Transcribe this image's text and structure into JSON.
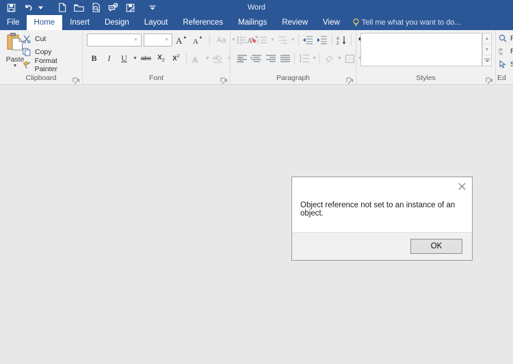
{
  "window": {
    "title": "Word",
    "titlebar_color": "#2b5797",
    "canvas_color": "#e8e8e8",
    "ribbon_color": "#f1f1f1"
  },
  "quick_access": {
    "items": [
      {
        "name": "save-icon",
        "tooltip": "Save"
      },
      {
        "name": "undo-icon",
        "tooltip": "Undo"
      },
      {
        "name": "undo-dropdown-caret-icon",
        "tooltip": "Undo options"
      },
      {
        "name": "new-document-icon",
        "tooltip": "New"
      },
      {
        "name": "open-folder-icon",
        "tooltip": "Open"
      },
      {
        "name": "print-preview-icon",
        "tooltip": "Print Preview and Print"
      },
      {
        "name": "spelling-grammar-icon",
        "tooltip": "Spelling & Grammar"
      },
      {
        "name": "save-as-icon",
        "tooltip": "Save As"
      },
      {
        "name": "customize-quick-access-caret-icon",
        "tooltip": "Customize Quick Access Toolbar"
      }
    ]
  },
  "tabs": [
    {
      "label": "File",
      "active": false,
      "name": "tab-file"
    },
    {
      "label": "Home",
      "active": true,
      "name": "tab-home"
    },
    {
      "label": "Insert",
      "active": false,
      "name": "tab-insert"
    },
    {
      "label": "Design",
      "active": false,
      "name": "tab-design"
    },
    {
      "label": "Layout",
      "active": false,
      "name": "tab-layout"
    },
    {
      "label": "References",
      "active": false,
      "name": "tab-references"
    },
    {
      "label": "Mailings",
      "active": false,
      "name": "tab-mailings"
    },
    {
      "label": "Review",
      "active": false,
      "name": "tab-review"
    },
    {
      "label": "View",
      "active": false,
      "name": "tab-view"
    }
  ],
  "tell_me": {
    "label": "Tell me what you want to do...",
    "icon": "lightbulb-icon"
  },
  "ribbon": {
    "groups": [
      {
        "name": "clipboard",
        "label": "Clipboard",
        "paste": {
          "label": "Paste",
          "icon": "paste-icon",
          "has_dropdown": true
        },
        "items": [
          {
            "label": "Cut",
            "icon": "scissors-icon"
          },
          {
            "label": "Copy",
            "icon": "copy-icon"
          },
          {
            "label": "Format Painter",
            "icon": "format-painter-icon"
          }
        ]
      },
      {
        "name": "font",
        "label": "Font",
        "font_name": {
          "value": "",
          "placeholder": ""
        },
        "font_size": {
          "value": "",
          "placeholder": ""
        },
        "row1": [
          {
            "label": "A",
            "icon": "grow-font-icon",
            "enabled": true
          },
          {
            "label": "A",
            "icon": "shrink-font-icon",
            "enabled": true
          },
          {
            "label": "Aa",
            "icon": "change-case-icon",
            "enabled": false
          },
          {
            "label": "",
            "icon": "clear-formatting-icon",
            "enabled": true
          }
        ],
        "row2": [
          {
            "label": "B",
            "icon": "bold-icon",
            "enabled": true
          },
          {
            "label": "I",
            "icon": "italic-icon",
            "enabled": true
          },
          {
            "label": "U",
            "icon": "underline-icon",
            "enabled": true
          },
          {
            "label": "abc",
            "icon": "strikethrough-icon",
            "enabled": true
          },
          {
            "label": "X2",
            "icon": "subscript-icon",
            "enabled": true
          },
          {
            "label": "X2",
            "icon": "superscript-icon",
            "enabled": true
          },
          {
            "label": "A",
            "icon": "text-effects-icon",
            "enabled": false
          },
          {
            "label": "ab",
            "icon": "text-highlight-color-icon",
            "enabled": false
          },
          {
            "label": "A",
            "icon": "font-color-icon",
            "enabled": false
          }
        ]
      },
      {
        "name": "paragraph",
        "label": "Paragraph",
        "row1": [
          {
            "icon": "bullets-icon",
            "enabled": false
          },
          {
            "icon": "numbering-icon",
            "enabled": false
          },
          {
            "icon": "multilevel-list-icon",
            "enabled": false
          },
          {
            "icon": "decrease-indent-icon",
            "enabled": true
          },
          {
            "icon": "increase-indent-icon",
            "enabled": true
          },
          {
            "icon": "sort-icon",
            "enabled": true
          },
          {
            "icon": "show-formatting-marks-icon",
            "enabled": true
          }
        ],
        "row2": [
          {
            "icon": "align-left-icon",
            "enabled": true
          },
          {
            "icon": "align-center-icon",
            "enabled": true
          },
          {
            "icon": "align-right-icon",
            "enabled": true
          },
          {
            "icon": "justify-icon",
            "enabled": true
          },
          {
            "icon": "line-spacing-icon",
            "enabled": false
          },
          {
            "icon": "shading-icon",
            "enabled": false
          },
          {
            "icon": "borders-icon",
            "enabled": false
          }
        ]
      },
      {
        "name": "styles",
        "label": "Styles",
        "gallery_empty": true,
        "scroll_buttons": [
          {
            "icon": "scroll-up-icon"
          },
          {
            "icon": "scroll-down-icon"
          },
          {
            "icon": "styles-more-icon"
          }
        ]
      },
      {
        "name": "editing",
        "label": "Ed",
        "items": [
          {
            "label": "F",
            "icon": "search-icon"
          },
          {
            "label": "R",
            "icon": "replace-icon"
          },
          {
            "label": "S",
            "icon": "select-cursor-icon"
          }
        ]
      }
    ]
  },
  "dialog": {
    "name": "error-dialog",
    "title": "",
    "message": "Object reference not set to an instance of an object.",
    "close_icon": "close-icon",
    "buttons": [
      {
        "label": "OK",
        "name": "ok-button",
        "default": true
      }
    ]
  }
}
